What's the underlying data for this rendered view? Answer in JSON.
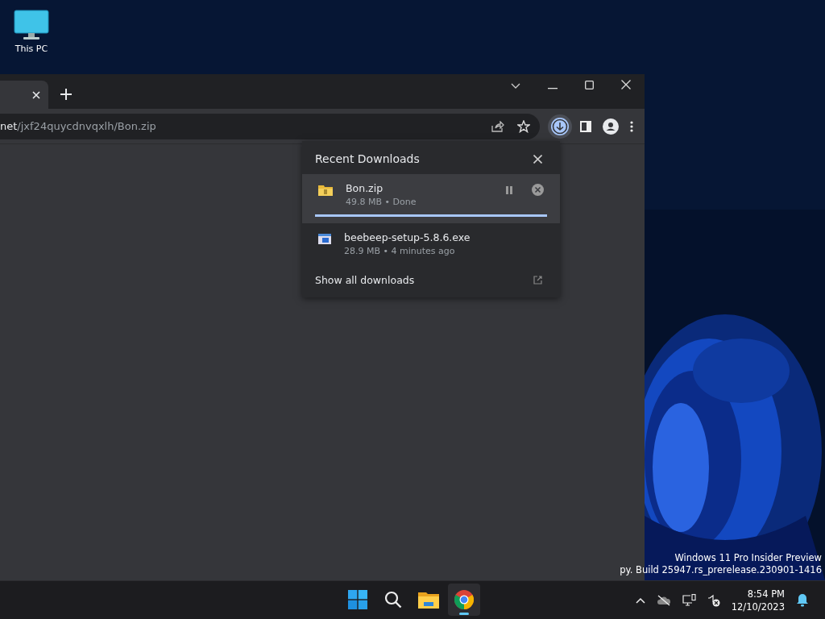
{
  "desktop": {
    "icons": [
      {
        "label": "This PC"
      }
    ]
  },
  "browser": {
    "address": {
      "host": "net",
      "path": "/jxf24quycdnvqxlh/Bon.zip"
    },
    "downloads_panel": {
      "title": "Recent Downloads",
      "items": [
        {
          "kind": "archive",
          "name": "Bon.zip",
          "detail": "49.8 MB • Done",
          "selected": true,
          "level": 1
        },
        {
          "kind": "installer",
          "name": "beebeep-setup-5.8.6.exe",
          "detail": "28.9 MB • 4 minutes ago",
          "selected": false
        }
      ],
      "footer": "Show all downloads"
    }
  },
  "watermark": [
    "Windows 11 Pro Insider Preview",
    "py. Build 25947.rs_prerelease.230901-1416"
  ],
  "taskbar": {
    "apps": [
      {
        "kind": "start",
        "running": false
      },
      {
        "kind": "search",
        "running": false
      },
      {
        "kind": "explorer",
        "running": false
      },
      {
        "kind": "chrome",
        "running": true
      }
    ],
    "clock": {
      "time": "8:54 PM",
      "date": "12/10/2023"
    }
  }
}
